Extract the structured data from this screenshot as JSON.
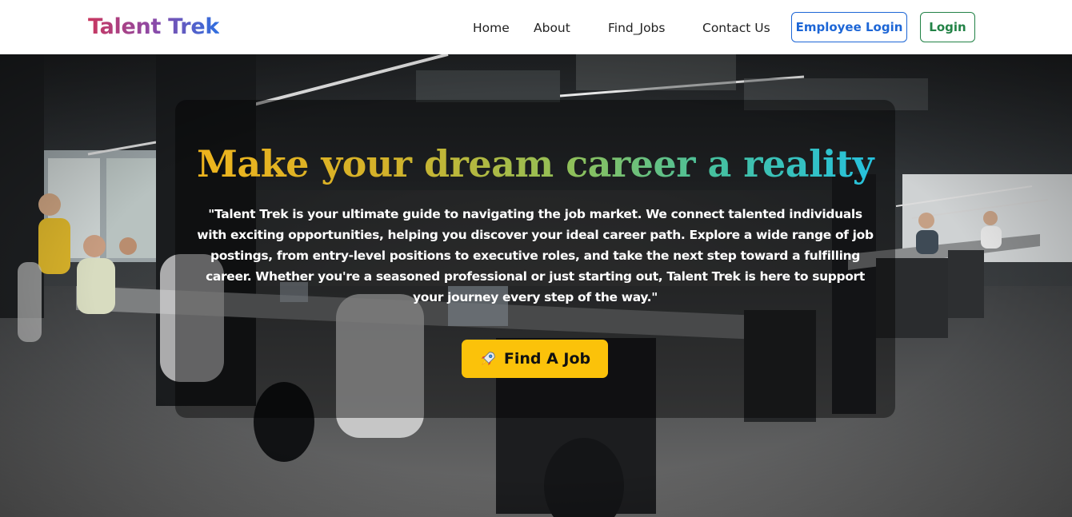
{
  "brand": {
    "name": "Talent Trek"
  },
  "nav": {
    "links": [
      {
        "label": "Home"
      },
      {
        "label": "About"
      },
      {
        "label": "Find_Jobs"
      },
      {
        "label": "Contact Us"
      }
    ],
    "employee_login_label": "Employee Login",
    "login_label": "Login"
  },
  "hero": {
    "title": "Make your dream career a reality",
    "description": "\"Talent Trek is your ultimate guide to navigating the job market. We connect talented individuals with exciting opportunities, helping you discover your ideal career path. Explore a wide range of job postings, from entry-level positions to executive roles, and take the next step toward a fulfilling career. Whether you're a seasoned professional or just starting out, Talent Trek is here to support your journey every step of the way.\"",
    "cta_label": "Find A Job",
    "cta_icon": "rocket-icon",
    "background_image": "office-workspace-photo"
  },
  "colors": {
    "employee_login": "#1d66d6",
    "login": "#228246",
    "cta": "#fbc20a"
  }
}
